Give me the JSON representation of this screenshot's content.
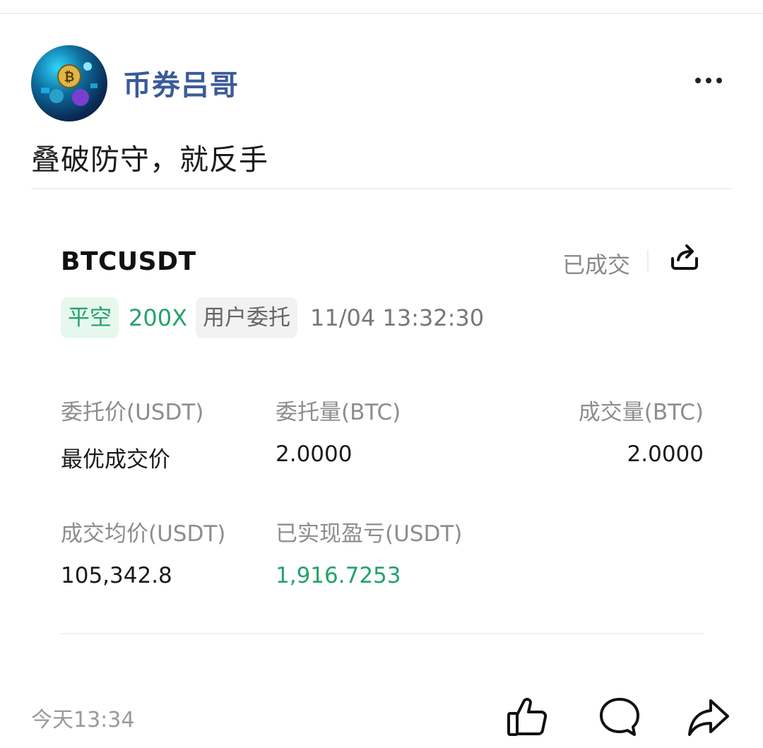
{
  "author": {
    "name": "币券吕哥",
    "avatar_icon": "crypto-coins-avatar"
  },
  "post": {
    "text": "叠破防守，就反手"
  },
  "order": {
    "symbol": "BTCUSDT",
    "status": "已成交",
    "side_tag": "平空",
    "leverage": "200X",
    "source_tag": "用户委托",
    "time": "11/04 13:32:30",
    "fields": [
      {
        "label": "委托价(USDT)",
        "value": "最优成交价"
      },
      {
        "label": "委托量(BTC)",
        "value": "2.0000"
      },
      {
        "label": "成交量(BTC)",
        "value": "2.0000"
      },
      {
        "label": "成交均价(USDT)",
        "value": "105,342.8"
      },
      {
        "label": "已实现盈亏(USDT)",
        "value": "1,916.7253"
      }
    ]
  },
  "footer": {
    "time": "今天13:34"
  },
  "colors": {
    "accent_green": "#23a36b",
    "author_blue": "#3b5a9a"
  }
}
